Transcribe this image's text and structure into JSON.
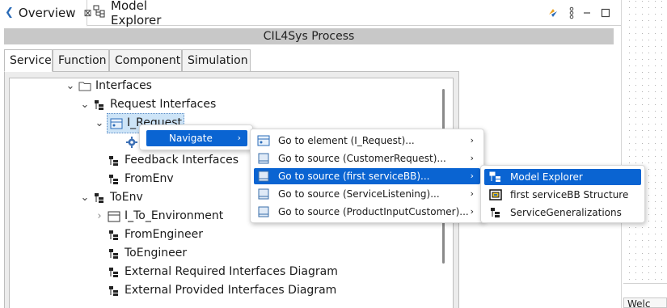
{
  "tabs": {
    "overview": "Overview",
    "model_explorer": "Model Explorer",
    "close_glyph": "⊠"
  },
  "editor": {
    "title": "CIL4Sys Process"
  },
  "inner_tabs": [
    "Service",
    "Function",
    "Component",
    "Simulation"
  ],
  "tree": {
    "items": [
      {
        "label": "Interfaces",
        "icon": "folder-icon",
        "twisty": "expanded"
      },
      {
        "label": "Request Interfaces",
        "icon": "interface-package-icon",
        "twisty": "expanded"
      },
      {
        "label": "I_Request",
        "icon": "interface-icon",
        "twisty": "expanded",
        "selected": true
      },
      {
        "label": "",
        "icon": "gear-icon",
        "twisty": "none"
      },
      {
        "label": "Feedback Interfaces",
        "icon": "interface-package-icon",
        "twisty": "none"
      },
      {
        "label": "FromEnv",
        "icon": "interface-package-icon",
        "twisty": "none"
      },
      {
        "label": "ToEnv",
        "icon": "interface-package-icon",
        "twisty": "expanded"
      },
      {
        "label": "I_To_Environment",
        "icon": "interface-icon",
        "twisty": "collapsed"
      },
      {
        "label": "FromEngineer",
        "icon": "interface-package-icon",
        "twisty": "none"
      },
      {
        "label": "ToEngineer",
        "icon": "interface-package-icon",
        "twisty": "none"
      },
      {
        "label": "External Required Interfaces Diagram",
        "icon": "interface-package-icon",
        "twisty": "none"
      },
      {
        "label": "External Provided Interfaces Diagram",
        "icon": "interface-package-icon",
        "twisty": "none"
      }
    ]
  },
  "context_menu": {
    "navigate": "Navigate"
  },
  "navigate_menu": {
    "items": [
      {
        "label": "Go to element (I_Request)...",
        "icon": "element-icon"
      },
      {
        "label": "Go to source (CustomerRequest)...",
        "icon": "source-icon"
      },
      {
        "label": "Go to source (first serviceBB)...",
        "icon": "source-icon",
        "highlighted": true
      },
      {
        "label": "Go to source (ServiceListening)...",
        "icon": "source-icon"
      },
      {
        "label": "Go to source (ProductInputCustomer)...",
        "icon": "source-icon"
      }
    ]
  },
  "submenu": {
    "items": [
      {
        "label": "Model Explorer",
        "icon": "model-explorer-icon",
        "highlighted": true
      },
      {
        "label": "first serviceBB Structure",
        "icon": "structure-diagram-icon"
      },
      {
        "label": "ServiceGeneralizations",
        "icon": "generalization-diagram-icon"
      }
    ]
  },
  "right_panel": {
    "bottom_label": "Welc"
  },
  "colors": {
    "highlight": "#0a64d2",
    "title_strip": "#c8c8c8",
    "selection": "#cde4f7"
  }
}
